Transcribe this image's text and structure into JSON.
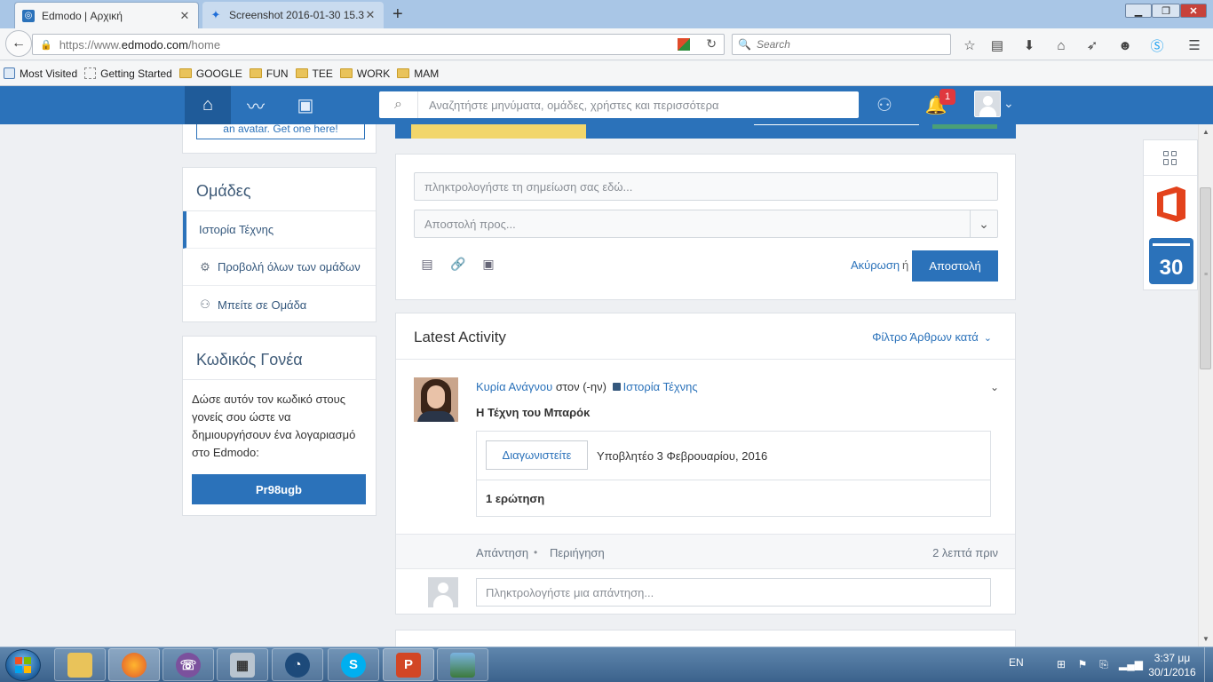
{
  "browser": {
    "tabs": [
      {
        "title": "Edmodo | Αρχική",
        "active": true
      },
      {
        "title": "Screenshot 2016-01-30 15.3...",
        "active": false
      }
    ],
    "url_prefix": "https://www.",
    "url_host": "edmodo.com",
    "url_path": "/home",
    "search_placeholder": "Search",
    "bookmarks": [
      "Most Visited",
      "Getting Started",
      "GOOGLE",
      "FUN",
      "TEE",
      "WORK",
      "MAM"
    ]
  },
  "edmodo_nav": {
    "search_placeholder": "Αναζητήστε μηνύματα, ομάδες, χρήστες και περισσότερα",
    "notification_count": "1",
    "accent": "#2b72ba"
  },
  "sidebar": {
    "avatar_link": "an avatar. Get one here!",
    "groups_title": "Ομάδες",
    "groups": [
      {
        "label": "Ιστορία Τέχνης",
        "icon": ""
      },
      {
        "label": "Προβολή όλων των ομάδων",
        "icon": "gear-icon"
      },
      {
        "label": "Μπείτε σε Ομάδα",
        "icon": "join-group-icon"
      }
    ],
    "parent_title": "Κωδικός Γονέα",
    "parent_desc": "Δώσε αυτόν τον κωδικό στους γονείς σου ώστε να δημιουργήσουν ένα λογαριασμό στο Edmodo:",
    "parent_code": "Pr98ugb"
  },
  "composer": {
    "note_placeholder": "πληκτρολογήστε τη σημείωση σας εδώ...",
    "sendto_placeholder": "Αποστολή προς...",
    "cancel": "Ακύρωση",
    "or": "ή",
    "send": "Αποστολή"
  },
  "activity": {
    "title": "Latest Activity",
    "filter": "Φίλτρο Άρθρων κατά",
    "post": {
      "author": "Κυρία Ανάγνου",
      "connector": "στον (-ην)",
      "group": "Ιστορία Τέχνης",
      "title": "Η Τέχνη του Μπαρόκ",
      "quiz_button": "Διαγωνιστείτε",
      "due": "Υποβλητέο 3 Φεβρουαρίου, 2016",
      "question_count": "1 ερώτηση",
      "reply": "Απάντηση",
      "preview": "Περιήγηση",
      "time": "2 λεπτά πριν",
      "reply_placeholder": "Πληκτρολογήστε μια απάντηση..."
    }
  },
  "widgets": {
    "calendar_day": "30"
  },
  "taskbar": {
    "language": "EN",
    "time": "3:37 μμ",
    "date": "30/1/2016"
  }
}
